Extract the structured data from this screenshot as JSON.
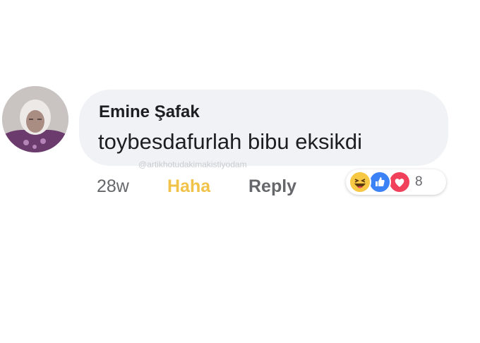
{
  "comment": {
    "author": "Emine Şafak",
    "text": "toybesdafurlah bibu eksikdi",
    "watermark": "@artikhotudakimakistiyodam",
    "time": "28w",
    "reaction_label": "Haha",
    "reply_label": "Reply",
    "reactions": {
      "icons": [
        "haha-emoji-icon",
        "like-icon",
        "love-icon"
      ],
      "count": "8"
    }
  },
  "colors": {
    "bubble": "#f0f2f5",
    "haha_link": "#f0c247",
    "meta_gray": "#65676b",
    "like_blue": "#3b82f6",
    "love_red": "#f0405a"
  }
}
